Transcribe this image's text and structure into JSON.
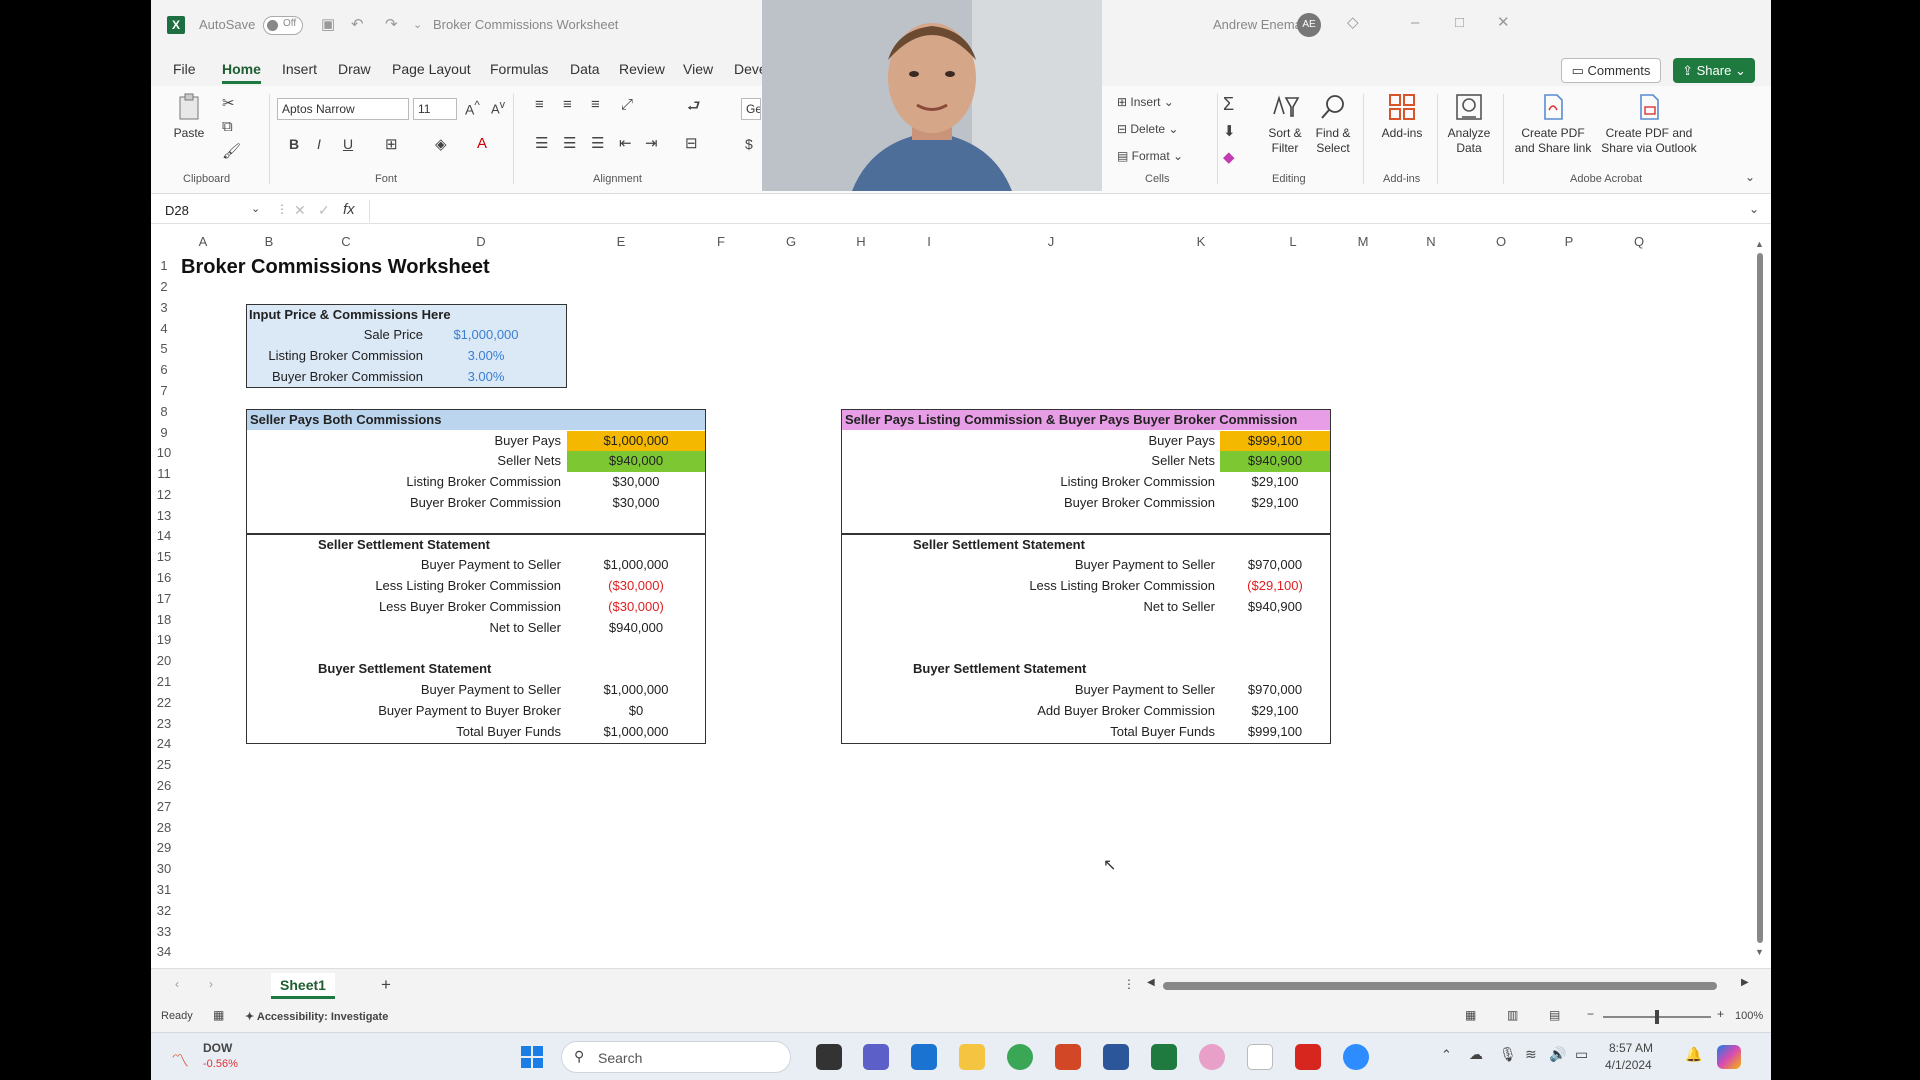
{
  "titlebar": {
    "autosave_label": "AutoSave",
    "autosave_state": "Off",
    "document_title": "Broker Commissions Worksheet",
    "user_name": "Andrew Enemann",
    "user_initials": "AE"
  },
  "menu": {
    "tabs": [
      "File",
      "Home",
      "Insert",
      "Draw",
      "Page Layout",
      "Formulas",
      "Data",
      "Review",
      "View",
      "Devel"
    ],
    "active": "Home",
    "comments_label": "Comments",
    "share_label": "Share"
  },
  "ribbon": {
    "paste_label": "Paste",
    "clipboard_label": "Clipboard",
    "font_name": "Aptos Narrow",
    "font_size": "11",
    "font_label": "Font",
    "alignment_label": "Alignment",
    "number_format": "Gen",
    "insert_label": "Insert",
    "delete_label": "Delete",
    "format_label": "Format",
    "cells_label": "Cells",
    "sort_label": "Sort & Filter",
    "find_label": "Find & Select",
    "editing_label": "Editing",
    "addins_label": "Add-ins",
    "addins_group": "Add-ins",
    "analyze_label": "Analyze Data",
    "pdf_share_label": "Create PDF and Share link",
    "pdf_outlook_label": "Create PDF and Share via Outlook",
    "adobe_label": "Adobe Acrobat"
  },
  "formula": {
    "name_box": "D28",
    "fx": "fx"
  },
  "columns": [
    "A",
    "B",
    "C",
    "D",
    "E",
    "F",
    "G",
    "H",
    "I",
    "J",
    "K",
    "L",
    "M",
    "N",
    "O",
    "P",
    "Q"
  ],
  "rows": [
    "1",
    "2",
    "3",
    "4",
    "5",
    "6",
    "7",
    "8",
    "9",
    "10",
    "11",
    "12",
    "13",
    "14",
    "15",
    "16",
    "17",
    "18",
    "19",
    "20",
    "21",
    "22",
    "23",
    "24",
    "25",
    "26",
    "27",
    "28",
    "29",
    "30",
    "31",
    "32",
    "33",
    "34"
  ],
  "sheet": {
    "title": "Broker Commissions Worksheet",
    "inputs": {
      "header": "Input Price & Commissions Here",
      "sale_price_label": "Sale Price",
      "sale_price": "$1,000,000",
      "listing_label": "Listing Broker Commission",
      "listing_value": "3.00%",
      "buyer_label": "Buyer Broker Commission",
      "buyer_value": "3.00%"
    },
    "left": {
      "header": "Seller Pays Both Commissions",
      "buyer_pays_label": "Buyer Pays",
      "buyer_pays": "$1,000,000",
      "seller_nets_label": "Seller Nets",
      "seller_nets": "$940,000",
      "listing_label": "Listing Broker Commission",
      "listing": "$30,000",
      "buyer_broker_label": "Buyer Broker Commission",
      "buyer_broker": "$30,000",
      "seller_stmt": "Seller Settlement Statement",
      "s1_label": "Buyer Payment to Seller",
      "s1": "$1,000,000",
      "s2_label": "Less Listing Broker Commission",
      "s2": "($30,000)",
      "s3_label": "Less Buyer Broker Commission",
      "s3": "($30,000)",
      "s4_label": "Net to Seller",
      "s4": "$940,000",
      "buyer_stmt": "Buyer Settlement Statement",
      "b1_label": "Buyer Payment to Seller",
      "b1": "$1,000,000",
      "b2_label": "Buyer Payment to Buyer Broker",
      "b2": "$0",
      "b3_label": "Total Buyer Funds",
      "b3": "$1,000,000"
    },
    "right": {
      "header": "Seller Pays Listing Commission & Buyer Pays Buyer Broker Commission",
      "buyer_pays_label": "Buyer Pays",
      "buyer_pays": "$999,100",
      "seller_nets_label": "Seller Nets",
      "seller_nets": "$940,900",
      "listing_label": "Listing Broker Commission",
      "listing": "$29,100",
      "buyer_broker_label": "Buyer Broker Commission",
      "buyer_broker": "$29,100",
      "seller_stmt": "Seller Settlement Statement",
      "s1_label": "Buyer Payment to Seller",
      "s1": "$970,000",
      "s2_label": "Less Listing Broker Commission",
      "s2": "($29,100)",
      "s3_label": "Net to Seller",
      "s3": "$940,900",
      "buyer_stmt": "Buyer Settlement Statement",
      "b1_label": "Buyer Payment to Seller",
      "b1": "$970,000",
      "b2_label": "Add Buyer Broker Commission",
      "b2": "$29,100",
      "b3_label": "Total Buyer Funds",
      "b3": "$999,100"
    }
  },
  "sheet_tabs": {
    "active": "Sheet1",
    "add": "+"
  },
  "status": {
    "ready": "Ready",
    "accessibility": "Accessibility: Investigate",
    "zoom": "100%"
  },
  "taskbar": {
    "ticker_name": "DOW",
    "ticker_change": "-0.56%",
    "search_placeholder": "Search",
    "time": "8:57 AM",
    "date": "4/1/2024"
  },
  "colors": {
    "excel_green": "#1e7a3e",
    "orange_fill": "#f5b800",
    "green_fill": "#7dc832",
    "blue_header": "#bcd5ee",
    "pink_header": "#e79ee6",
    "input_fill": "#dbe8f6",
    "negative": "#e02020",
    "input_text": "#3a7fd0"
  }
}
